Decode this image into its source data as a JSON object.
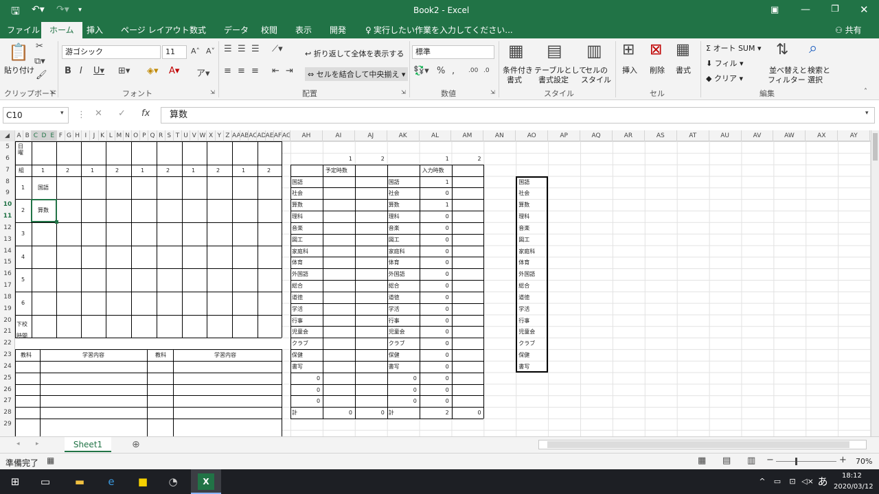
{
  "window": {
    "title": "Book2 - Excel"
  },
  "tabs": [
    "ファイル",
    "ホーム",
    "挿入",
    "ページ レイアウト",
    "数式",
    "データ",
    "校閲",
    "表示",
    "開発"
  ],
  "tell_me": "実行したい作業を入力してください...",
  "share": "共有",
  "ribbon": {
    "paste": "貼り付け",
    "clipboard": "クリップボード",
    "font_name": "游ゴシック",
    "font_size": "11",
    "font": "フォント",
    "wrap_text": "折り返して全体を表示する",
    "merge_center": "セルを結合して中央揃え",
    "alignment": "配置",
    "number_format": "標準",
    "number": "数値",
    "cond_format": "条件付き",
    "cond_format2": "書式",
    "table_format": "テーブルとして",
    "table_format2": "書式設定",
    "cell_style": "セルの",
    "cell_style2": "スタイル",
    "style": "スタイル",
    "insert": "挿入",
    "delete": "削除",
    "format": "書式",
    "cells": "セル",
    "autosum": "オート SUM",
    "fill": "フィル",
    "clear": "クリア",
    "sort": "並べ替えと",
    "sort2": "フィルター",
    "find": "検索と",
    "find2": "選択",
    "editing": "編集"
  },
  "formula": {
    "name_box": "C10",
    "value": "算数"
  },
  "left_cols": [
    "A",
    "B",
    "C",
    "D",
    "E",
    "F",
    "G",
    "H",
    "I",
    "J",
    "K",
    "L",
    "M",
    "N",
    "O",
    "P",
    "Q",
    "R",
    "S",
    "T",
    "U",
    "V",
    "W",
    "X",
    "Y",
    "Z",
    "AA",
    "AB",
    "AC",
    "AD",
    "AE",
    "AF",
    "AG"
  ],
  "right_cols": [
    "AH",
    "AI",
    "AJ",
    "AK",
    "AL",
    "AM",
    "AN",
    "AO",
    "AP",
    "AQ",
    "AR",
    "AS",
    "AT",
    "AU",
    "AV",
    "AW",
    "AX",
    "AY"
  ],
  "rows": [
    "5",
    "6",
    "7",
    "8",
    "9",
    "10",
    "11",
    "12",
    "13",
    "14",
    "15",
    "16",
    "17",
    "18",
    "19",
    "20",
    "21",
    "22",
    "23",
    "24",
    "25",
    "26",
    "27",
    "28",
    "29"
  ],
  "timetable": {
    "top_label": "日\n曜",
    "group_row": [
      "組",
      "1",
      "2",
      "1",
      "2",
      "1",
      "2",
      "1",
      "2",
      "1",
      "2"
    ],
    "periods": [
      "1",
      "2",
      "3",
      "4",
      "5",
      "6"
    ],
    "cell_c8": "国語",
    "cell_c10": "算数",
    "dismiss": "下校\n時間",
    "sub_headers": [
      "教科",
      "学習内容",
      "教科",
      "学習内容"
    ]
  },
  "subjects": [
    "国語",
    "社会",
    "算数",
    "理科",
    "音楽",
    "図工",
    "家庭科",
    "体育",
    "外国語",
    "総合",
    "道徳",
    "学活",
    "行事",
    "児童会",
    "クラブ",
    "保健",
    "書写"
  ],
  "plan": {
    "h1": "1",
    "h2": "2",
    "title": "予定時数",
    "extra": [
      "0",
      "0",
      "0"
    ],
    "total_label": "計",
    "totals": [
      "0",
      "0"
    ]
  },
  "input": {
    "h1": "1",
    "h2": "2",
    "title": "入力時数",
    "values": [
      "1",
      "0",
      "1",
      "0",
      "0",
      "0",
      "0",
      "0",
      "0",
      "0",
      "0",
      "0",
      "0",
      "0",
      "0",
      "0",
      "0"
    ],
    "extra_left": [
      "0",
      "0",
      "0"
    ],
    "extra": [
      "0",
      "0",
      "0"
    ],
    "total_label": "計",
    "totals": [
      "2",
      "0"
    ]
  },
  "sheet": {
    "name": "Sheet1"
  },
  "status": {
    "ready": "準備完了",
    "zoom": "70%"
  },
  "taskbar": {
    "time": "18:12",
    "date": "2020/03/12",
    "ime": "あ"
  }
}
